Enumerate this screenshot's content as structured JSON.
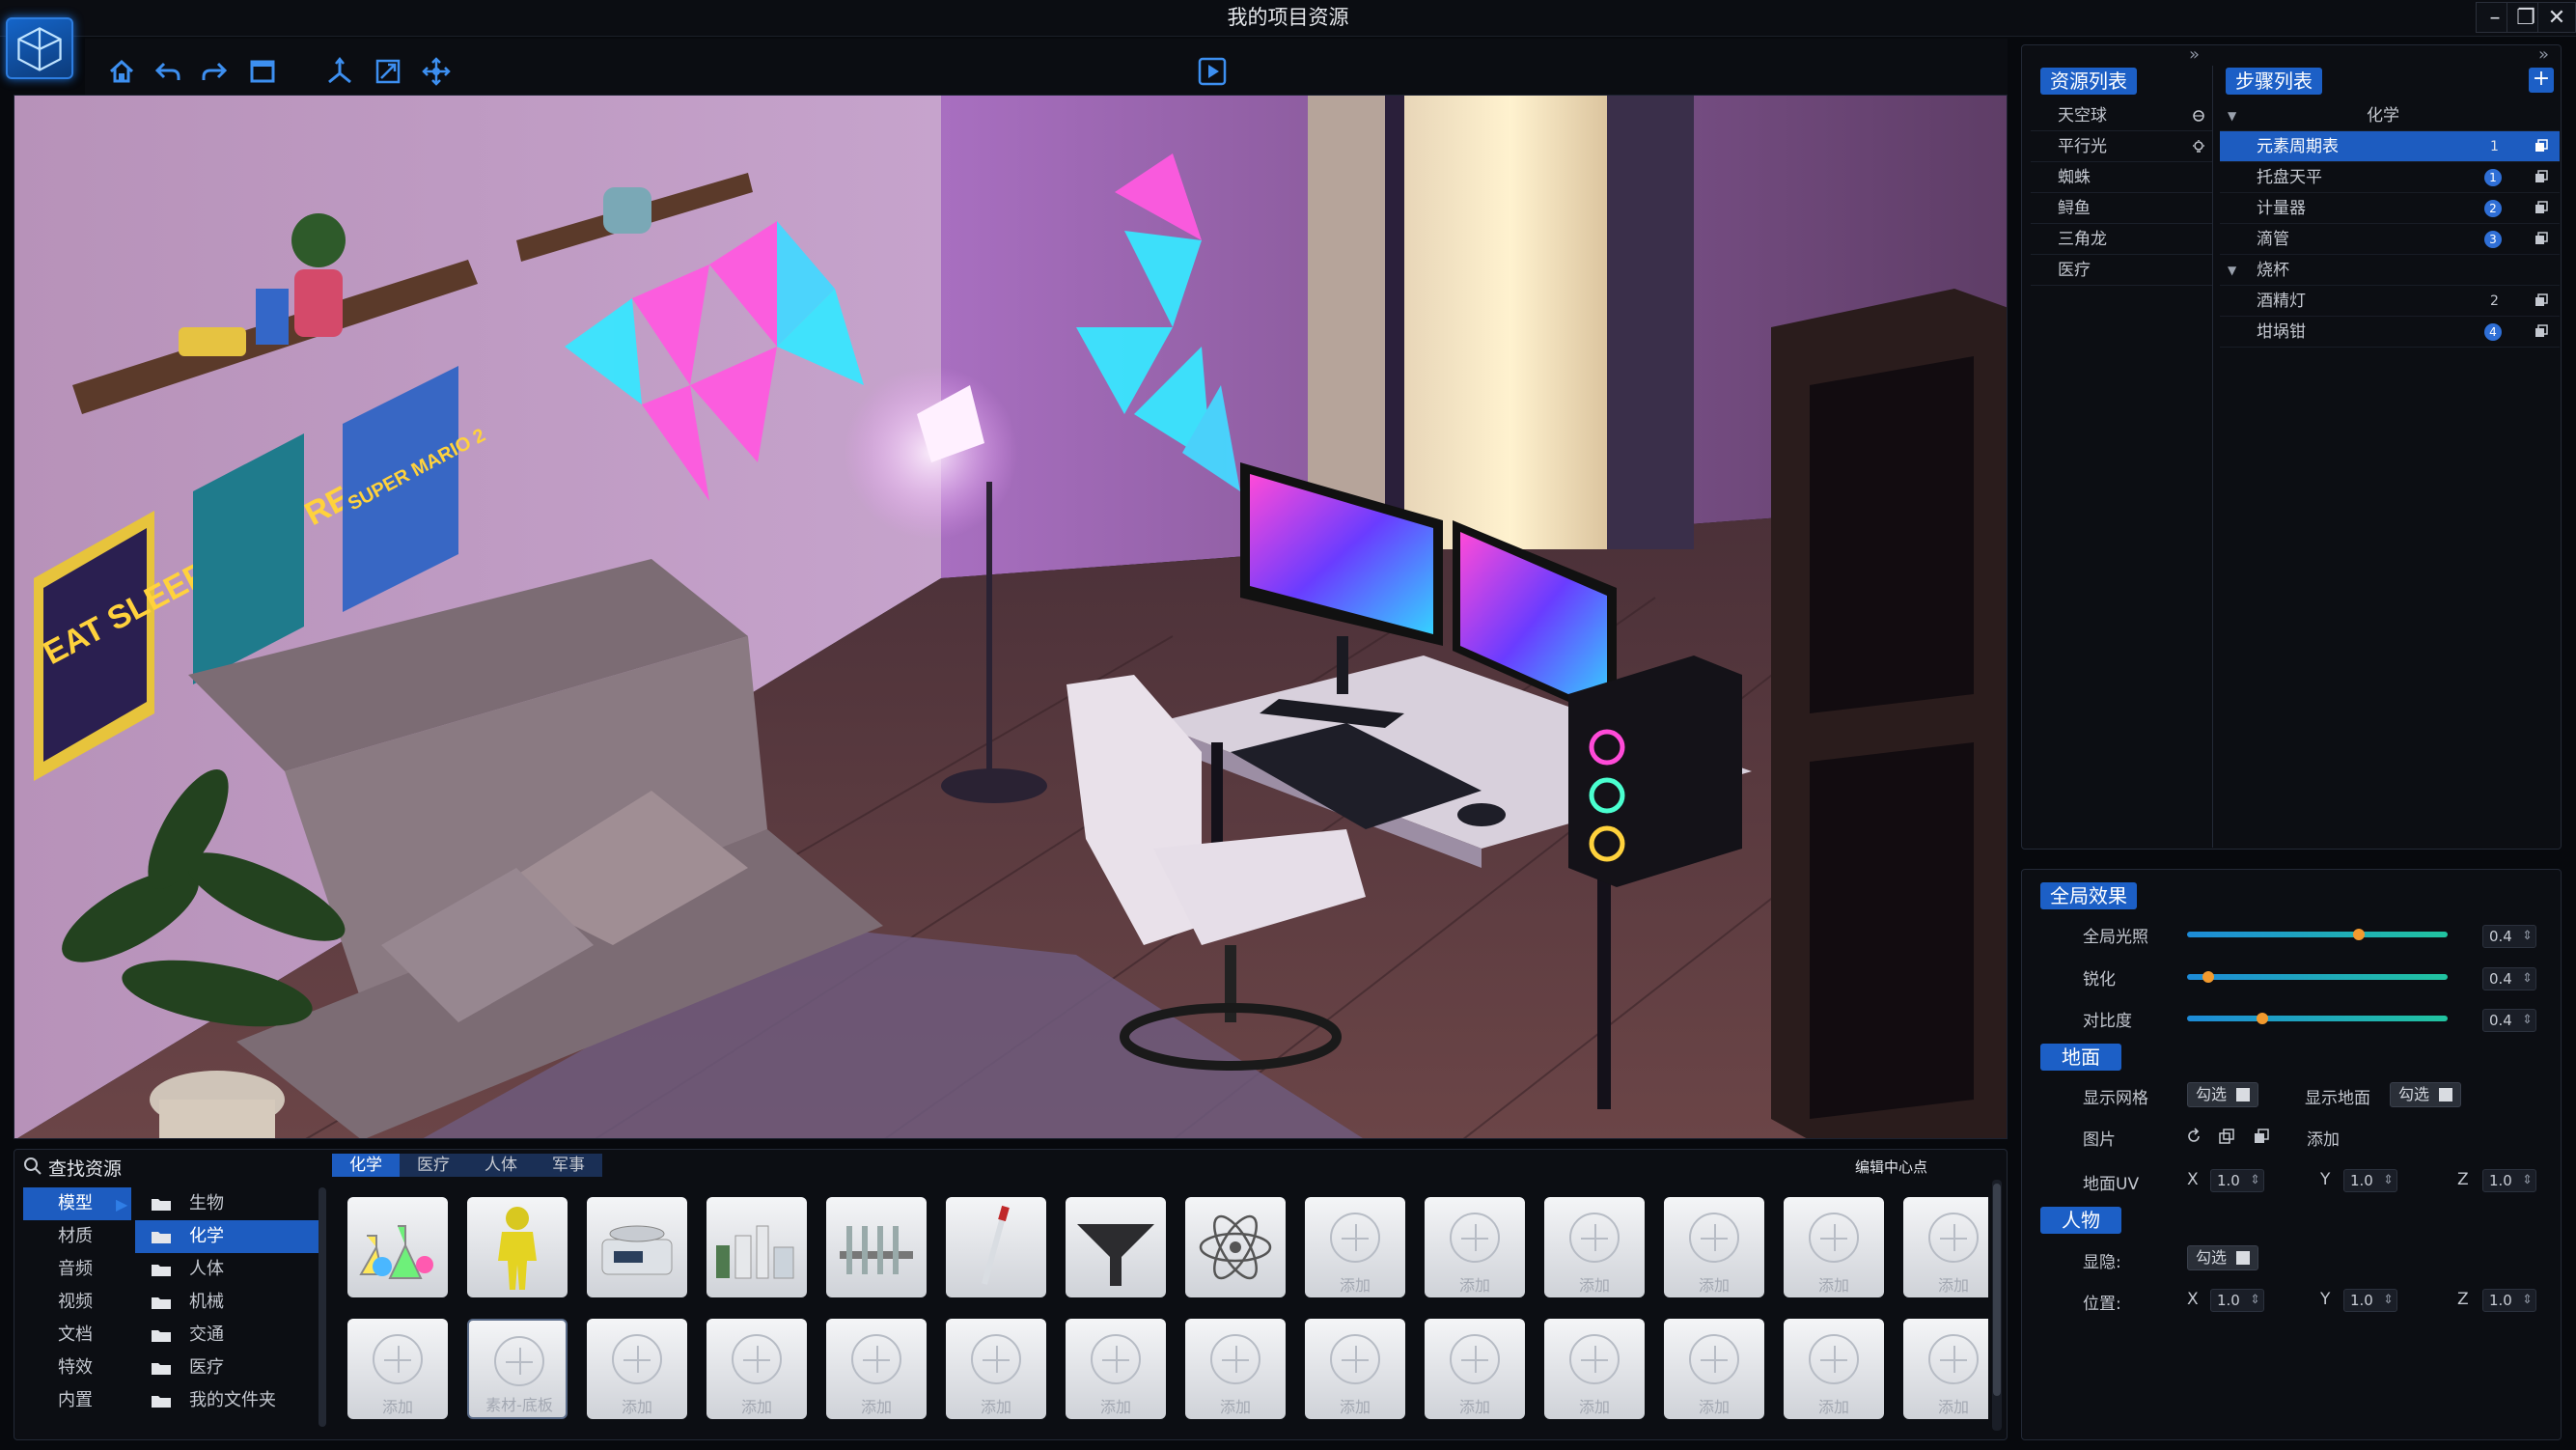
{
  "window": {
    "title": "我的项目资源",
    "min": "–",
    "max": "❐",
    "close": "✕"
  },
  "toolbar": {
    "icons": [
      "home-icon",
      "undo-icon",
      "redo-icon",
      "frame-icon",
      "axis-icon",
      "scale-icon",
      "move-icon"
    ],
    "play": "play-icon"
  },
  "resources": {
    "title": "资源列表",
    "collapse": "»",
    "items": [
      {
        "label": "天空球",
        "icon": "sky-icon"
      },
      {
        "label": "平行光",
        "icon": "light-icon"
      },
      {
        "label": "蜘蛛"
      },
      {
        "label": "鲟鱼"
      },
      {
        "label": "三角龙"
      },
      {
        "label": "医疗"
      }
    ]
  },
  "steps": {
    "title": "步骤列表",
    "collapse": "»",
    "add": "+",
    "groups": [
      {
        "label": "化学",
        "items": [
          {
            "label": "元素周期表",
            "num": "1",
            "style": "plain",
            "selected": true
          },
          {
            "label": "托盘天平",
            "num": "1",
            "style": "badge"
          },
          {
            "label": "计量器",
            "num": "2",
            "style": "badge"
          },
          {
            "label": "滴管",
            "num": "3",
            "style": "badge"
          }
        ]
      },
      {
        "label": "烧杯",
        "items": [
          {
            "label": "酒精灯",
            "num": "2",
            "style": "plain"
          },
          {
            "label": "坩埚钳",
            "num": "4",
            "style": "badge"
          }
        ]
      }
    ]
  },
  "effects": {
    "title": "全局效果",
    "sliders": [
      {
        "label": "全局光照",
        "value": "0.4",
        "level": 0.66
      },
      {
        "label": "锐化",
        "value": "0.4",
        "level": 0.08
      },
      {
        "label": "对比度",
        "value": "0.4",
        "level": 0.29
      }
    ]
  },
  "ground": {
    "title": "地面",
    "show_grid": "显示网格",
    "show_ground": "显示地面",
    "check": "勾选",
    "image": "图片",
    "add": "添加",
    "uv": "地面UV",
    "x": "X",
    "y": "Y",
    "z": "Z",
    "xv": "1.0",
    "yv": "1.0",
    "zv": "1.0"
  },
  "person": {
    "title": "人物",
    "visible": "显隐:",
    "check": "勾选",
    "position": "位置:",
    "x": "X",
    "y": "Y",
    "z": "Z",
    "xv": "1.0",
    "yv": "1.0",
    "zv": "1.0"
  },
  "bottom": {
    "search": "查找资源",
    "categories": [
      "模型",
      "材质",
      "音频",
      "视频",
      "文档",
      "特效",
      "内置"
    ],
    "folders": [
      "生物",
      "化学",
      "人体",
      "机械",
      "交通",
      "医疗",
      "我的文件夹"
    ],
    "tabs": [
      "化学",
      "医疗",
      "人体",
      "军事"
    ],
    "edit_center": "编辑中心点",
    "row1": [
      {
        "kind": "flasks"
      },
      {
        "kind": "hazmat"
      },
      {
        "kind": "scale"
      },
      {
        "kind": "bottles"
      },
      {
        "kind": "rack"
      },
      {
        "kind": "pipette"
      },
      {
        "kind": "funnel"
      },
      {
        "kind": "atom"
      },
      {
        "kind": "add",
        "label": "添加"
      },
      {
        "kind": "add",
        "label": "添加"
      },
      {
        "kind": "add",
        "label": "添加"
      },
      {
        "kind": "add",
        "label": "添加"
      },
      {
        "kind": "add",
        "label": "添加"
      },
      {
        "kind": "add",
        "label": "添加"
      }
    ],
    "row2": [
      {
        "label": "添加"
      },
      {
        "label": "素材-底板"
      },
      {
        "label": "添加"
      },
      {
        "label": "添加"
      },
      {
        "label": "添加"
      },
      {
        "label": "添加"
      },
      {
        "label": "添加"
      },
      {
        "label": "添加"
      },
      {
        "label": "添加"
      },
      {
        "label": "添加"
      },
      {
        "label": "添加"
      },
      {
        "label": "添加"
      },
      {
        "label": "添加"
      },
      {
        "label": "添加"
      }
    ]
  },
  "scene": {
    "posters": [
      "EAT SLEEP GAME REPEAT",
      "SUPER MARIO 2"
    ]
  },
  "colors": {
    "accent": "#1d5cc0",
    "panel": "#0c0e13",
    "wall": "#b68ab6",
    "floor": "#5a3a3a"
  }
}
